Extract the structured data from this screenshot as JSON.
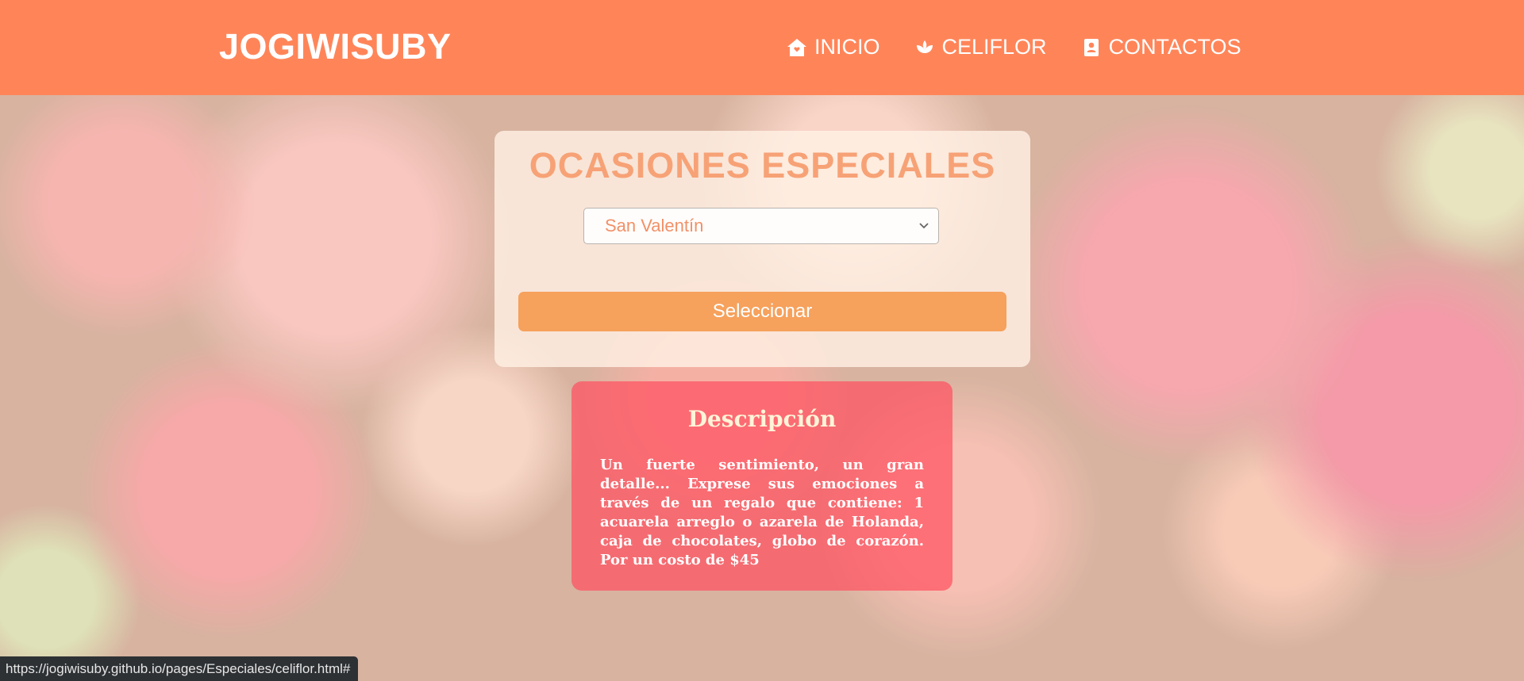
{
  "header": {
    "brand": "JOGIWISUBY",
    "nav": [
      {
        "label": "INICIO",
        "icon": "home-icon"
      },
      {
        "label": "CELIFLOR",
        "icon": "lotus-icon"
      },
      {
        "label": "CONTACTOS",
        "icon": "contact-book-icon"
      }
    ]
  },
  "card": {
    "title": "OCASIONES ESPECIALES",
    "select_value": "San Valentín",
    "button_label": "Seleccionar"
  },
  "description": {
    "title": "Descripción",
    "text": "Un fuerte sentimiento, un gran detalle... Exprese sus emociones a través de un regalo que contiene: 1 acuarela arreglo o azarela de Holanda, caja de chocolates, globo de corazón. Por un costo de $45"
  },
  "status_bar": {
    "url": "https://jogiwisuby.github.io/pages/Especiales/celiflor.html#"
  },
  "colors": {
    "header": "#ff8559",
    "title": "#f7a276",
    "button": "#f6a15c",
    "description_bg": "#ff505f"
  }
}
